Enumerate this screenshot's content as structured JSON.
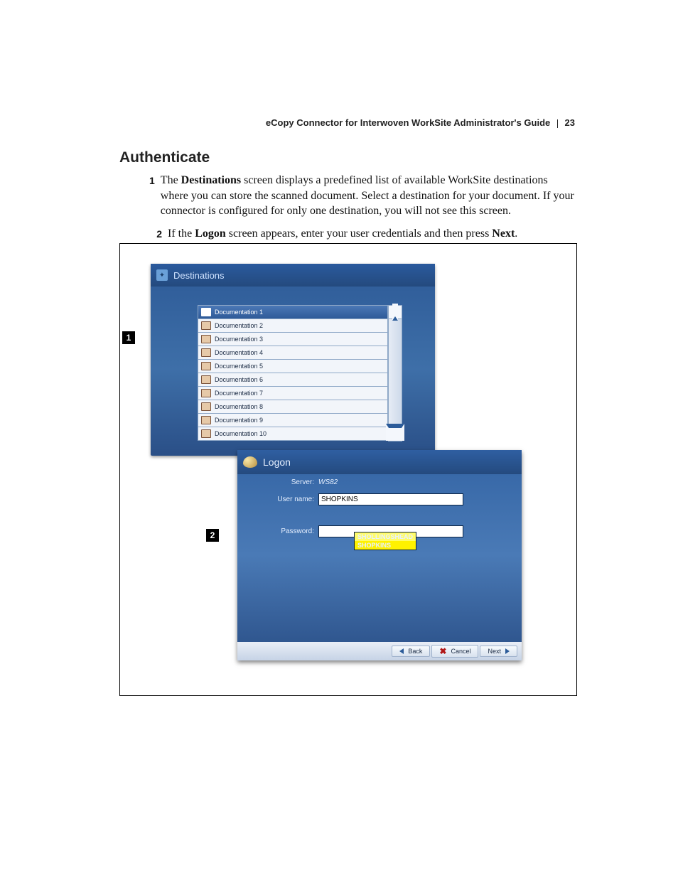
{
  "header": {
    "title": "eCopy Connector for Interwoven WorkSite Administrator's Guide",
    "page": "23"
  },
  "section_heading": "Authenticate",
  "steps": [
    {
      "n": "1",
      "pre": "The ",
      "b": "Destinations",
      "post": " screen displays a predefined list of available WorkSite destinations where you can store the scanned document. Select a destination for your document. If your connector is configured for only one destination, you will not see this screen."
    },
    {
      "n": "2",
      "pre": "If the ",
      "b": "Logon",
      "mid": " screen appears, enter your user credentials and then press ",
      "b2": "Next",
      "end": "."
    }
  ],
  "callouts": {
    "one": "1",
    "two": "2"
  },
  "destinations": {
    "title": "Destinations",
    "items": [
      "Documentation 1",
      "Documentation 2",
      "Documentation 3",
      "Documentation 4",
      "Documentation 5",
      "Documentation 6",
      "Documentation 7",
      "Documentation 8",
      "Documentation 9",
      "Documentation 10"
    ]
  },
  "logon": {
    "title": "Logon",
    "server_label": "Server:",
    "server_value": "WS82",
    "user_label": "User name:",
    "user_value": "SHOPKINS",
    "suggestions": [
      "SHOLLINGSHEAD",
      "SHOPKINS"
    ],
    "pass_label": "Password:",
    "pass_value": "",
    "back": "Back",
    "cancel": "Cancel",
    "next": "Next"
  }
}
